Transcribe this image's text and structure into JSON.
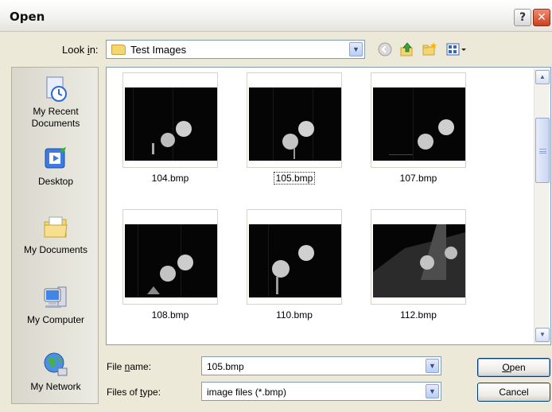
{
  "window": {
    "title": "Open",
    "help_icon": "?",
    "close_icon": "✕"
  },
  "lookin": {
    "label_pre": "Look ",
    "label_hot": "i",
    "label_post": "n:",
    "value": "Test Images"
  },
  "toolbar": {
    "icons": [
      "back-icon",
      "up-folder-icon",
      "new-folder-icon",
      "views-menu-icon"
    ]
  },
  "places": [
    {
      "label": "My Recent Documents",
      "icon": "recent-documents-icon"
    },
    {
      "label": "Desktop",
      "icon": "desktop-icon"
    },
    {
      "label": "My Documents",
      "icon": "my-documents-icon"
    },
    {
      "label": "My Computer",
      "icon": "my-computer-icon"
    },
    {
      "label": "My Network",
      "icon": "my-network-icon"
    }
  ],
  "files": [
    {
      "name": "104.bmp",
      "selected": false
    },
    {
      "name": "105.bmp",
      "selected": true
    },
    {
      "name": "107.bmp",
      "selected": false
    },
    {
      "name": "108.bmp",
      "selected": false
    },
    {
      "name": "110.bmp",
      "selected": false
    },
    {
      "name": "112.bmp",
      "selected": false
    }
  ],
  "filename": {
    "label_pre": "File ",
    "label_hot": "n",
    "label_post": "ame:",
    "value": "105.bmp"
  },
  "filetype": {
    "label_pre": "Files of ",
    "label_hot": "t",
    "label_post": "ype:",
    "value": "image files (*.bmp)"
  },
  "buttons": {
    "open_hot": "O",
    "open_rest": "pen",
    "cancel": "Cancel"
  },
  "colors": {
    "accent": "#7f9db9",
    "close": "#c9421f",
    "dialog_bg": "#ece9d8"
  }
}
